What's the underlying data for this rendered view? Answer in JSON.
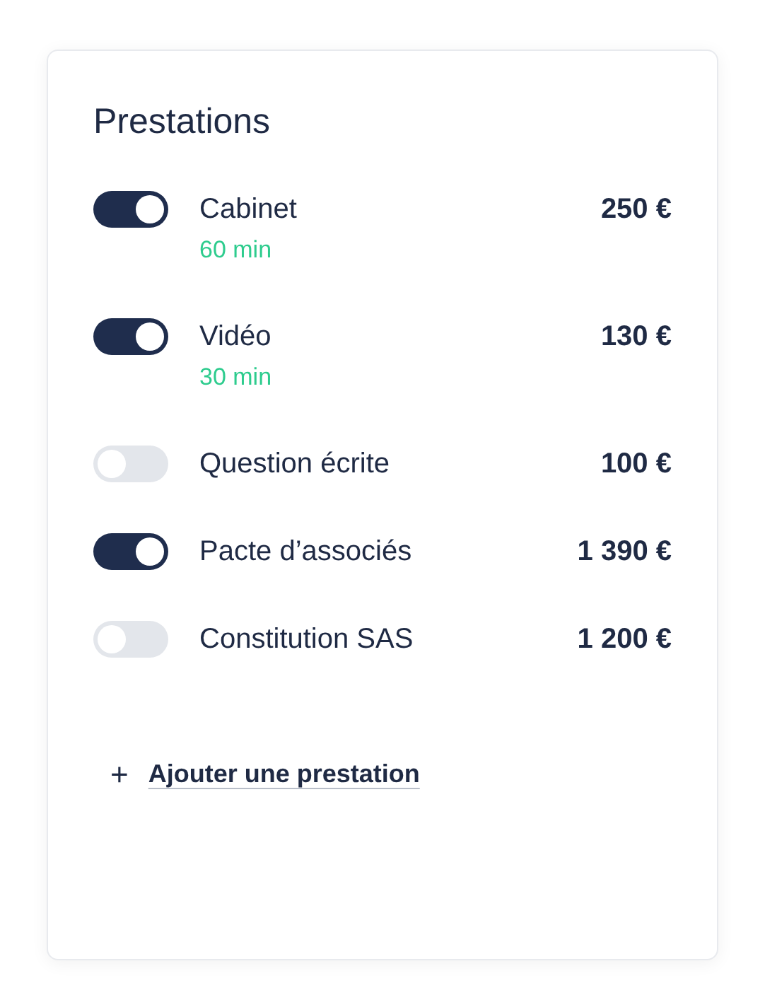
{
  "card": {
    "title": "Prestations",
    "items": [
      {
        "name": "Cabinet",
        "duration": "60 min",
        "price": "250 €",
        "on": true
      },
      {
        "name": "Vidéo",
        "duration": "30 min",
        "price": "130 €",
        "on": true
      },
      {
        "name": "Question écrite",
        "price": "100 €",
        "on": false
      },
      {
        "name": "Pacte d’associés",
        "price": "1 390 €",
        "on": true
      },
      {
        "name": "Constitution SAS",
        "price": "1 200 €",
        "on": false
      }
    ],
    "add_link": {
      "icon": "+",
      "label": "Ajouter une prestation"
    }
  }
}
